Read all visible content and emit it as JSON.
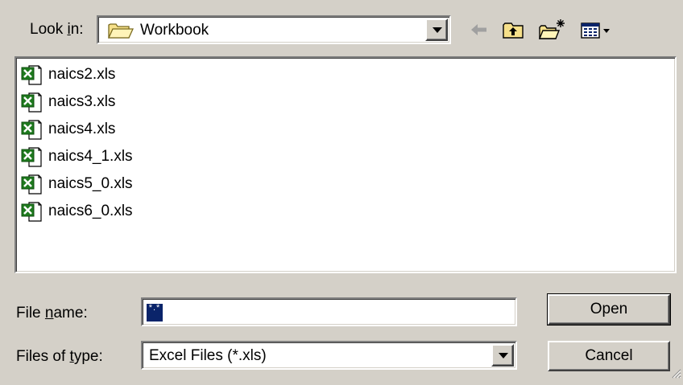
{
  "look_in": {
    "label_prefix": "Look ",
    "label_accel": "i",
    "label_suffix": "n:",
    "value": "Workbook"
  },
  "toolbar": {
    "icons": [
      "back-arrow-icon",
      "up-folder-icon",
      "new-folder-icon",
      "view-menu-icon"
    ]
  },
  "files": [
    {
      "name": "naics2.xls",
      "icon": "excel-file-icon"
    },
    {
      "name": "naics3.xls",
      "icon": "excel-file-icon"
    },
    {
      "name": "naics4.xls",
      "icon": "excel-file-icon"
    },
    {
      "name": "naics4_1.xls",
      "icon": "excel-file-icon"
    },
    {
      "name": "naics5_0.xls",
      "icon": "excel-file-icon"
    },
    {
      "name": "naics6_0.xls",
      "icon": "excel-file-icon"
    }
  ],
  "file_name": {
    "label_prefix": "File ",
    "label_accel": "n",
    "label_suffix": "ame:",
    "value": "*.*"
  },
  "files_of_type": {
    "label_prefix": "Files of ",
    "label_accel": "t",
    "label_suffix": "ype:",
    "value": "Excel Files (*.xls)"
  },
  "buttons": {
    "open_accel": "O",
    "open_rest": "pen",
    "cancel": "Cancel"
  },
  "colors": {
    "dialog_bg": "#d4d0c8",
    "selection": "#0a246a",
    "excel_green": "#1e7a1e"
  }
}
